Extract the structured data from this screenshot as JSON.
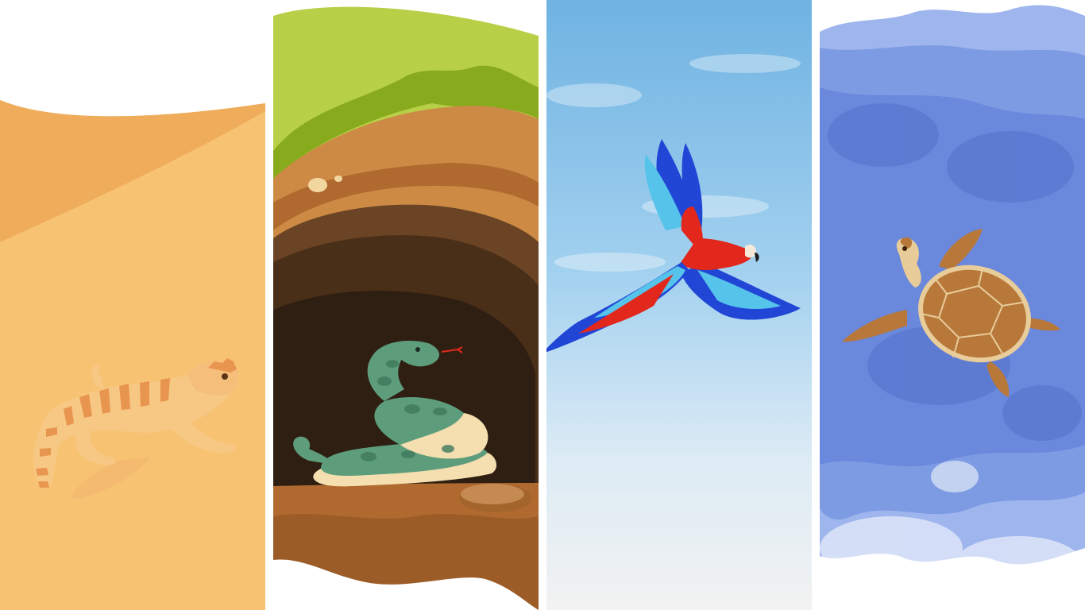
{
  "panels": [
    {
      "id": "desert",
      "subject": "bearded-dragon",
      "palette": {
        "sand": "#f6bb6b",
        "dune": "#efad5c",
        "body": "#f7cb86",
        "stripe": "#e8964f"
      }
    },
    {
      "id": "burrow",
      "subject": "snake",
      "palette": {
        "grass": "#b8cf48",
        "dirt": "#cd8a45",
        "hole": "#2f1f12",
        "snake": "#5e9d7c",
        "belly": "#f5dfb0"
      }
    },
    {
      "id": "sky",
      "subject": "macaw",
      "palette": {
        "sky": "#7fbde6",
        "wing": "#2146d6",
        "body": "#e2281c",
        "light": "#56c3ea"
      }
    },
    {
      "id": "ocean",
      "subject": "sea-turtle",
      "palette": {
        "water": "#6f8fe0",
        "shell": "#b8783a",
        "skin": "#e8cc9a"
      }
    }
  ]
}
